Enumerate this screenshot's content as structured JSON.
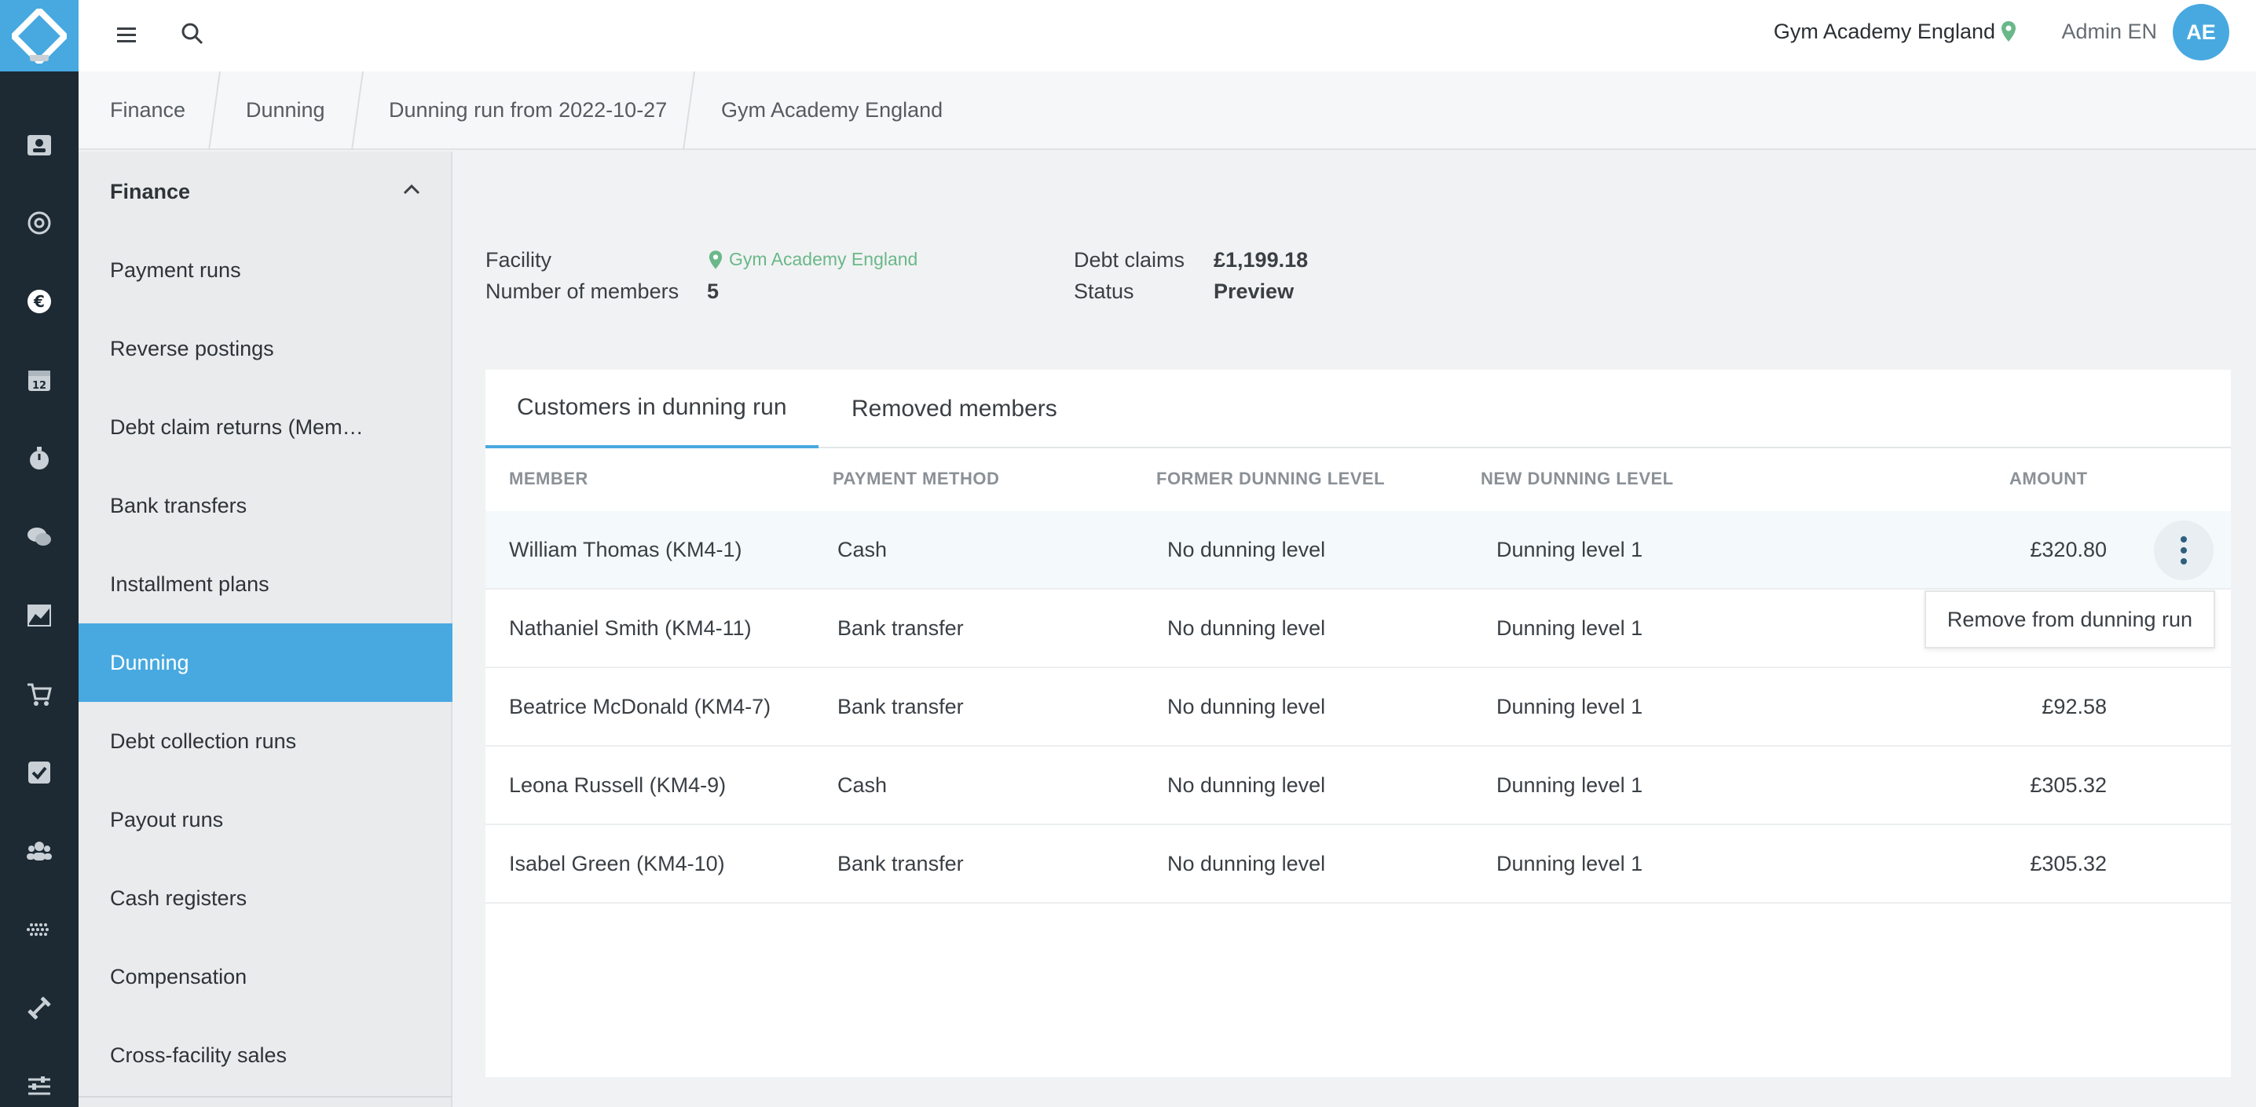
{
  "header": {
    "facility": "Gym Academy England",
    "user": "Admin EN",
    "avatar_initials": "AE",
    "accent_color": "#48a9e0",
    "location_color": "#6ab88a"
  },
  "breadcrumb": [
    "Finance",
    "Dunning",
    "Dunning run from 2022-10-27",
    "Gym Academy England"
  ],
  "sidebar": {
    "section": "Finance",
    "items": [
      {
        "label": "Payment runs"
      },
      {
        "label": "Reverse postings"
      },
      {
        "label": "Debt claim returns (Mem…"
      },
      {
        "label": "Bank transfers"
      },
      {
        "label": "Installment plans"
      },
      {
        "label": "Dunning",
        "active": true
      },
      {
        "label": "Debt collection runs"
      },
      {
        "label": "Payout runs"
      },
      {
        "label": "Cash registers"
      },
      {
        "label": "Compensation"
      },
      {
        "label": "Cross-facility sales"
      }
    ]
  },
  "info": {
    "facility_label": "Facility",
    "facility_value": "Gym Academy England",
    "members_label": "Number of members",
    "members_value": "5",
    "debt_label": "Debt claims",
    "debt_value": "£1,199.18",
    "status_label": "Status",
    "status_value": "Preview"
  },
  "tabs": [
    {
      "label": "Customers in dunning run",
      "active": true
    },
    {
      "label": "Removed members"
    }
  ],
  "table": {
    "columns": [
      "MEMBER",
      "PAYMENT METHOD",
      "FORMER DUNNING LEVEL",
      "NEW DUNNING LEVEL",
      "AMOUNT"
    ],
    "rows": [
      {
        "member": "William Thomas (KM4-1)",
        "method": "Cash",
        "former": "No dunning level",
        "new": "Dunning level 1",
        "amount": "£320.80"
      },
      {
        "member": "Nathaniel Smith (KM4-11)",
        "method": "Bank transfer",
        "former": "No dunning level",
        "new": "Dunning level 1",
        "amount": ""
      },
      {
        "member": "Beatrice McDonald (KM4-7)",
        "method": "Bank transfer",
        "former": "No dunning level",
        "new": "Dunning level 1",
        "amount": "£92.58"
      },
      {
        "member": "Leona Russell (KM4-9)",
        "method": "Cash",
        "former": "No dunning level",
        "new": "Dunning level 1",
        "amount": "£305.32"
      },
      {
        "member": "Isabel Green (KM4-10)",
        "method": "Bank transfer",
        "former": "No dunning level",
        "new": "Dunning level 1",
        "amount": "£305.32"
      }
    ]
  },
  "row_menu": {
    "remove_label": "Remove from dunning run"
  }
}
